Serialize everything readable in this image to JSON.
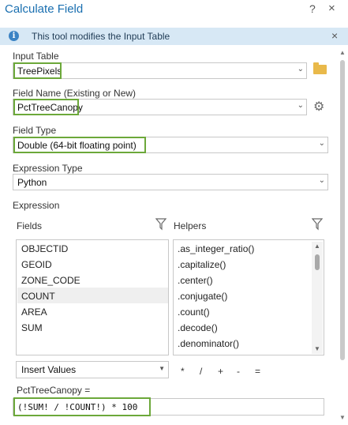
{
  "window": {
    "title": "Calculate Field",
    "help_label": "?",
    "close_label": "×"
  },
  "info": {
    "icon": "info-icon",
    "text": "This tool modifies the Input Table",
    "close_label": "×"
  },
  "input_table": {
    "label": "Input Table",
    "value": "TreePixels",
    "highlighted": true,
    "browse_icon": "folder-icon"
  },
  "field_name": {
    "label": "Field Name (Existing or New)",
    "value": "PctTreeCanopy",
    "highlighted": true,
    "settings_icon": "gear-icon"
  },
  "field_type": {
    "label": "Field Type",
    "value": "Double (64-bit floating point)",
    "highlighted": true
  },
  "expression_type": {
    "label": "Expression Type",
    "value": "Python"
  },
  "expression": {
    "label": "Expression",
    "fields_header": "Fields",
    "helpers_header": "Helpers",
    "filter_icon": "funnel-icon",
    "fields": [
      "OBJECTID",
      "GEOID",
      "ZONE_CODE",
      "COUNT",
      "AREA",
      "SUM"
    ],
    "selected_field": "COUNT",
    "helpers": [
      ".as_integer_ratio()",
      ".capitalize()",
      ".center()",
      ".conjugate()",
      ".count()",
      ".decode()",
      ".denominator()"
    ],
    "insert_values_label": "Insert Values",
    "operators": [
      "*",
      "/",
      "+",
      "-",
      "="
    ],
    "target_label": "PctTreeCanopy =",
    "code": "(!SUM! / !COUNT!)  * 100",
    "code_highlighted": true
  },
  "colors": {
    "accent": "#1a6fb0",
    "highlight": "#6ca83a",
    "infobar": "#d7e8f5"
  }
}
